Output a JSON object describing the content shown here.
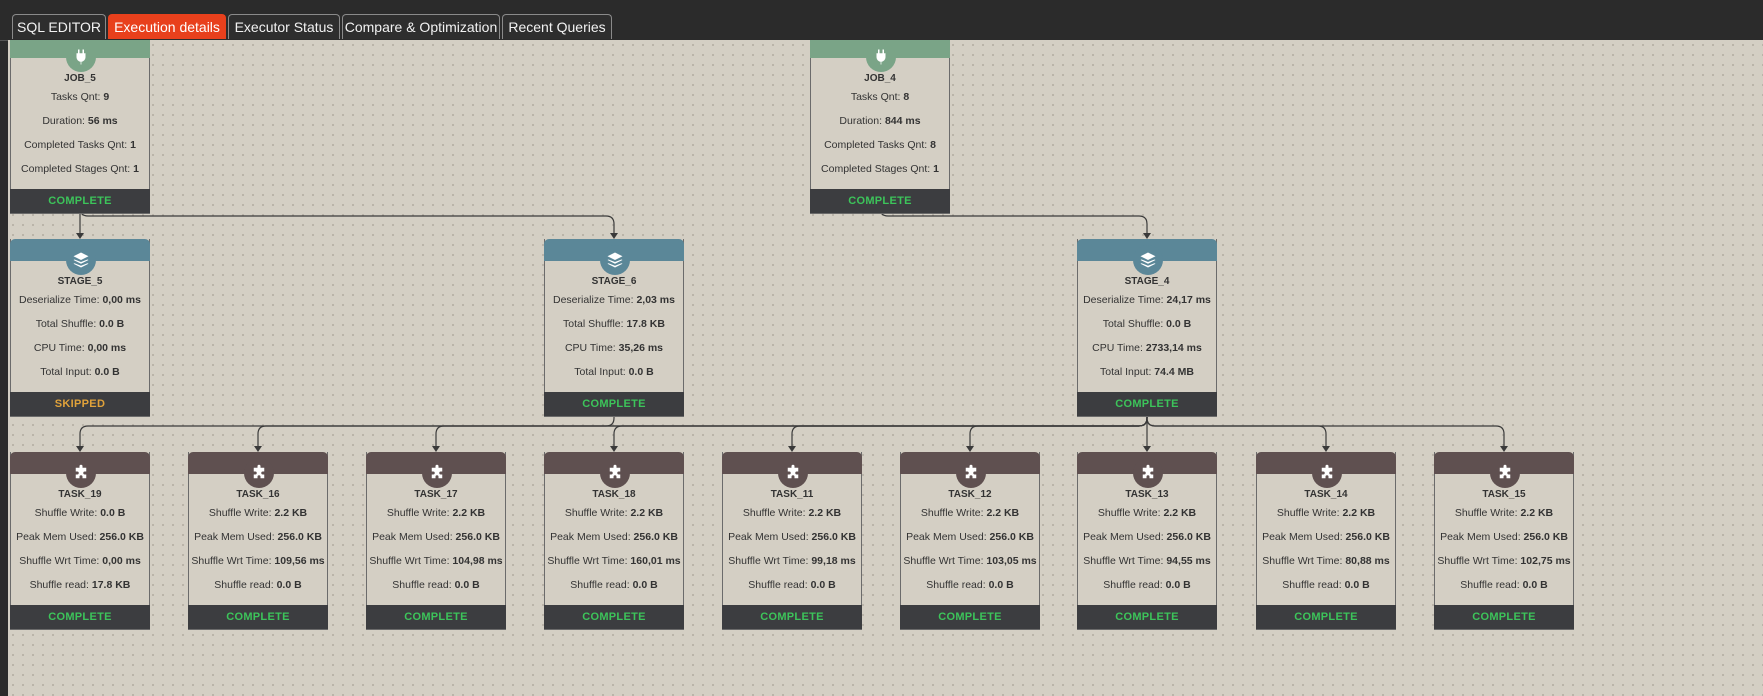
{
  "tabs": [
    {
      "label": "SQL EDITOR",
      "active": false
    },
    {
      "label": "Execution details",
      "active": true
    },
    {
      "label": "Executor Status",
      "active": false
    },
    {
      "label": "Compare & Optimization",
      "active": false
    },
    {
      "label": "Recent Queries",
      "active": false
    }
  ],
  "colors": {
    "accent": "#e8401c",
    "complete": "#3cc45a",
    "skipped": "#e0a23a",
    "job": "#7aa487",
    "stage": "#5b8798",
    "task": "#5f5050"
  },
  "icons": {
    "job": "plug-icon",
    "stage": "layers-icon",
    "task": "puzzle-icon"
  },
  "jobs": [
    {
      "title": "JOB_5",
      "status": "COMPLETE",
      "rows": [
        [
          "Tasks Qnt:",
          "9"
        ],
        [
          "Duration:",
          "56 ms"
        ],
        [
          "Completed Tasks Qnt:",
          "1"
        ],
        [
          "Completed Stages Qnt:",
          "1"
        ]
      ]
    },
    {
      "title": "JOB_4",
      "status": "COMPLETE",
      "rows": [
        [
          "Tasks Qnt:",
          "8"
        ],
        [
          "Duration:",
          "844 ms"
        ],
        [
          "Completed Tasks Qnt:",
          "8"
        ],
        [
          "Completed Stages Qnt:",
          "1"
        ]
      ]
    }
  ],
  "stages": [
    {
      "title": "STAGE_5",
      "status": "SKIPPED",
      "rows": [
        [
          "Deserialize Time:",
          "0,00 ms"
        ],
        [
          "Total Shuffle:",
          "0.0 B"
        ],
        [
          "CPU Time:",
          "0,00 ms"
        ],
        [
          "Total Input:",
          "0.0 B"
        ]
      ]
    },
    {
      "title": "STAGE_6",
      "status": "COMPLETE",
      "rows": [
        [
          "Deserialize Time:",
          "2,03 ms"
        ],
        [
          "Total Shuffle:",
          "17.8 KB"
        ],
        [
          "CPU Time:",
          "35,26 ms"
        ],
        [
          "Total Input:",
          "0.0 B"
        ]
      ]
    },
    {
      "title": "STAGE_4",
      "status": "COMPLETE",
      "rows": [
        [
          "Deserialize Time:",
          "24,17 ms"
        ],
        [
          "Total Shuffle:",
          "0.0 B"
        ],
        [
          "CPU Time:",
          "2733,14 ms"
        ],
        [
          "Total Input:",
          "74.4 MB"
        ]
      ]
    }
  ],
  "tasks": [
    {
      "title": "TASK_19",
      "status": "COMPLETE",
      "rows": [
        [
          "Shuffle Write:",
          "0.0 B"
        ],
        [
          "Peak Mem Used:",
          "256.0 KB"
        ],
        [
          "Shuffle Wrt Time:",
          "0,00 ms"
        ],
        [
          "Shuffle read:",
          "17.8 KB"
        ]
      ]
    },
    {
      "title": "TASK_16",
      "status": "COMPLETE",
      "rows": [
        [
          "Shuffle Write:",
          "2.2 KB"
        ],
        [
          "Peak Mem Used:",
          "256.0 KB"
        ],
        [
          "Shuffle Wrt Time:",
          "109,56 ms"
        ],
        [
          "Shuffle read:",
          "0.0 B"
        ]
      ]
    },
    {
      "title": "TASK_17",
      "status": "COMPLETE",
      "rows": [
        [
          "Shuffle Write:",
          "2.2 KB"
        ],
        [
          "Peak Mem Used:",
          "256.0 KB"
        ],
        [
          "Shuffle Wrt Time:",
          "104,98 ms"
        ],
        [
          "Shuffle read:",
          "0.0 B"
        ]
      ]
    },
    {
      "title": "TASK_18",
      "status": "COMPLETE",
      "rows": [
        [
          "Shuffle Write:",
          "2.2 KB"
        ],
        [
          "Peak Mem Used:",
          "256.0 KB"
        ],
        [
          "Shuffle Wrt Time:",
          "160,01 ms"
        ],
        [
          "Shuffle read:",
          "0.0 B"
        ]
      ]
    },
    {
      "title": "TASK_11",
      "status": "COMPLETE",
      "rows": [
        [
          "Shuffle Write:",
          "2.2 KB"
        ],
        [
          "Peak Mem Used:",
          "256.0 KB"
        ],
        [
          "Shuffle Wrt Time:",
          "99,18 ms"
        ],
        [
          "Shuffle read:",
          "0.0 B"
        ]
      ]
    },
    {
      "title": "TASK_12",
      "status": "COMPLETE",
      "rows": [
        [
          "Shuffle Write:",
          "2.2 KB"
        ],
        [
          "Peak Mem Used:",
          "256.0 KB"
        ],
        [
          "Shuffle Wrt Time:",
          "103,05 ms"
        ],
        [
          "Shuffle read:",
          "0.0 B"
        ]
      ]
    },
    {
      "title": "TASK_13",
      "status": "COMPLETE",
      "rows": [
        [
          "Shuffle Write:",
          "2.2 KB"
        ],
        [
          "Peak Mem Used:",
          "256.0 KB"
        ],
        [
          "Shuffle Wrt Time:",
          "94,55 ms"
        ],
        [
          "Shuffle read:",
          "0.0 B"
        ]
      ]
    },
    {
      "title": "TASK_14",
      "status": "COMPLETE",
      "rows": [
        [
          "Shuffle Write:",
          "2.2 KB"
        ],
        [
          "Peak Mem Used:",
          "256.0 KB"
        ],
        [
          "Shuffle Wrt Time:",
          "80,88 ms"
        ],
        [
          "Shuffle read:",
          "0.0 B"
        ]
      ]
    },
    {
      "title": "TASK_15",
      "status": "COMPLETE",
      "rows": [
        [
          "Shuffle Write:",
          "2.2 KB"
        ],
        [
          "Peak Mem Used:",
          "256.0 KB"
        ],
        [
          "Shuffle Wrt Time:",
          "102,75 ms"
        ],
        [
          "Shuffle read:",
          "0.0 B"
        ]
      ]
    }
  ]
}
